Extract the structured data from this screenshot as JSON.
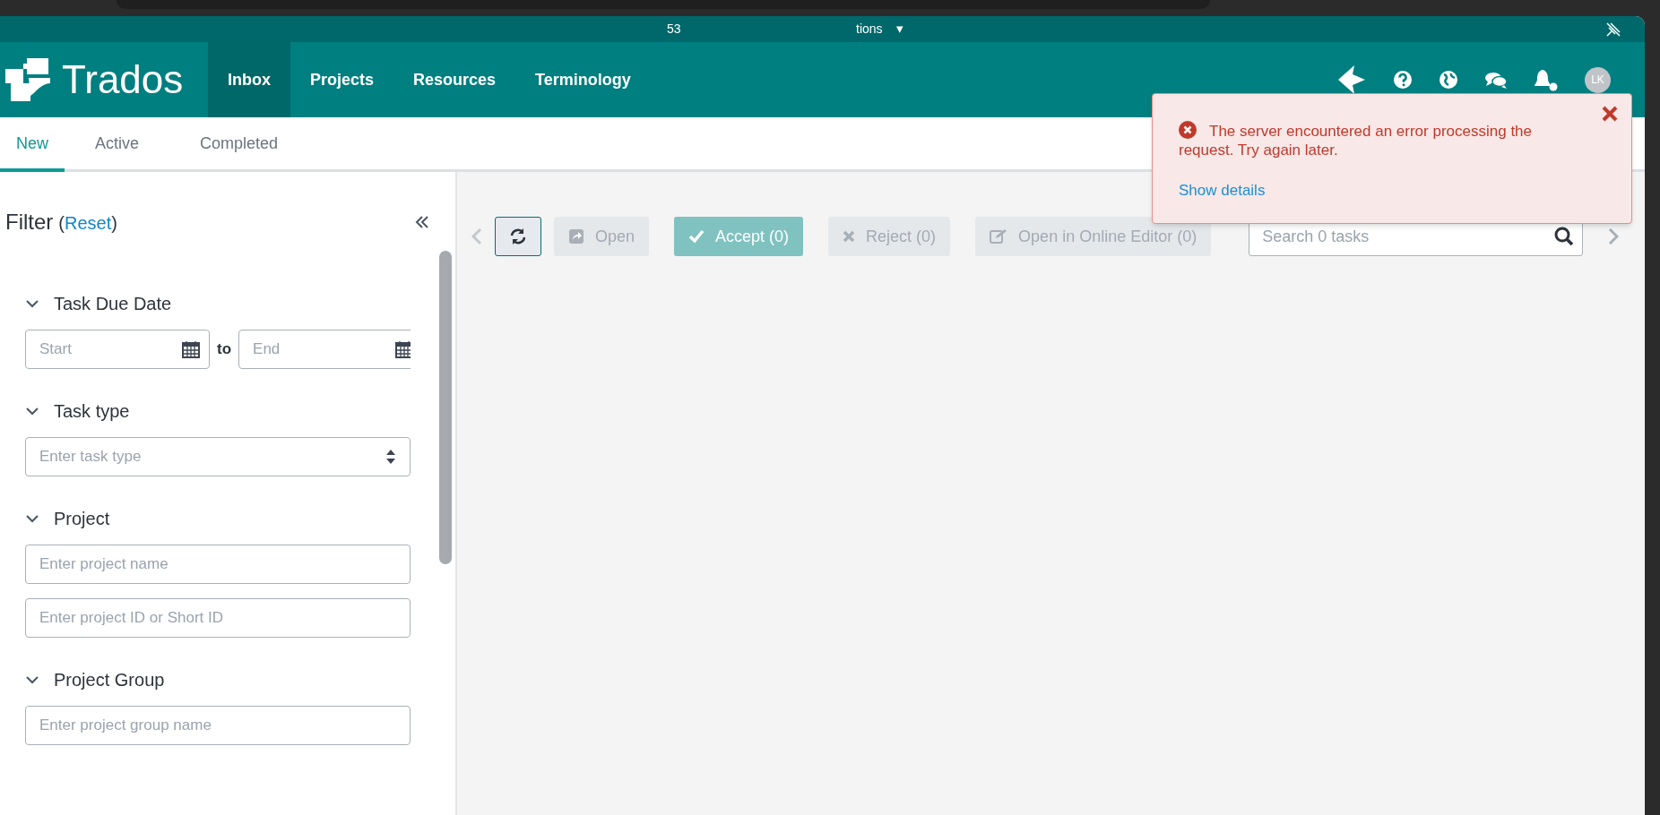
{
  "title_bar": {
    "texts": [
      "53",
      "tions"
    ],
    "dropdown": "▾"
  },
  "nav": {
    "logo": "Trados",
    "items": [
      {
        "label": "Inbox",
        "selected": true
      },
      {
        "label": "Projects",
        "selected": false
      },
      {
        "label": "Resources",
        "selected": false
      },
      {
        "label": "Terminology",
        "selected": false
      }
    ],
    "avatar": "LK"
  },
  "tabs": [
    {
      "label": "New",
      "selected": true
    },
    {
      "label": "Active",
      "selected": false
    },
    {
      "label": "Completed",
      "selected": false
    }
  ],
  "filter": {
    "title": "Filter",
    "reset_open": "(",
    "reset": "Reset",
    "reset_close": ")",
    "sections": [
      {
        "label": "Task Due Date",
        "expanded": true,
        "kind": "daterange",
        "start": {
          "placeholder": "Start"
        },
        "joiner": "to",
        "end": {
          "placeholder": "End"
        }
      },
      {
        "label": "Task type",
        "expanded": true,
        "kind": "select",
        "fields": [
          {
            "placeholder": "Enter task type"
          }
        ]
      },
      {
        "label": "Project",
        "expanded": true,
        "kind": "inputs",
        "fields": [
          {
            "placeholder": "Enter project name"
          },
          {
            "placeholder": "Enter project ID or Short ID"
          }
        ]
      },
      {
        "label": "Project Group",
        "expanded": true,
        "kind": "inputs",
        "fields": [
          {
            "placeholder": "Enter project group name"
          }
        ]
      }
    ]
  },
  "toolbar": {
    "buttons": [
      {
        "label": "Open",
        "kind": "open",
        "disabled": true
      },
      {
        "label": "Accept (0)",
        "kind": "accept",
        "disabled": false
      },
      {
        "label": "Reject (0)",
        "kind": "reject",
        "disabled": true
      },
      {
        "label": "Open in Online Editor (0)",
        "kind": "edit",
        "disabled": true
      }
    ],
    "search": {
      "placeholder": "Search 0 tasks"
    }
  },
  "error": {
    "message": "The server encountered an error processing the request. Try again later.",
    "link": "Show details"
  }
}
